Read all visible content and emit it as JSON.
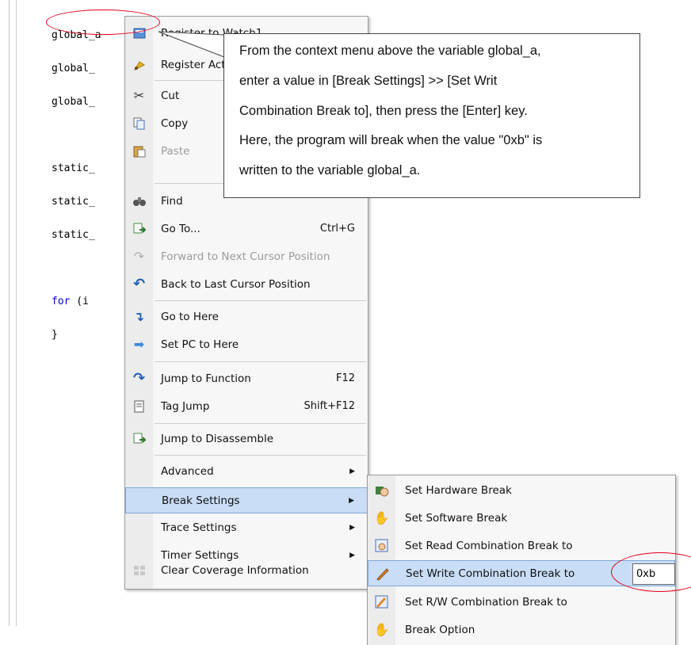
{
  "code_lines": [
    "global_a",
    "global_",
    "global_",
    "",
    "static_",
    "static_",
    "static_",
    "",
    "for (i",
    "}"
  ],
  "for_keyword": "for",
  "for_rest": " (i",
  "context_menu": {
    "items": [
      {
        "label": "Register to Watch1",
        "shortcut": "",
        "icon": "watch-icon"
      },
      {
        "label": "Register Action Event",
        "shortcut": "",
        "icon": "action-event-icon"
      },
      {
        "label": "Cut",
        "shortcut": "",
        "icon": "scissors-icon"
      },
      {
        "label": "Copy",
        "shortcut": "",
        "icon": "copy-icon"
      },
      {
        "label": "Paste",
        "shortcut": "",
        "icon": "paste-icon",
        "disabled": true
      },
      {
        "label": "Find",
        "shortcut": "",
        "icon": "binoculars-icon"
      },
      {
        "label": "Go To...",
        "shortcut": "Ctrl+G",
        "icon": "goto-icon"
      },
      {
        "label": "Forward to Next Cursor Position",
        "shortcut": "",
        "icon": "forward-icon",
        "disabled": true
      },
      {
        "label": "Back to Last Cursor Position",
        "shortcut": "",
        "icon": "back-icon"
      },
      {
        "label": "Go to Here",
        "shortcut": "",
        "icon": "go-here-icon"
      },
      {
        "label": "Set PC to Here",
        "shortcut": "",
        "icon": "set-pc-icon"
      },
      {
        "label": "Jump to Function",
        "shortcut": "F12",
        "icon": "jump-function-icon"
      },
      {
        "label": "Tag Jump",
        "shortcut": "Shift+F12",
        "icon": "tag-jump-icon"
      },
      {
        "label": "Jump to Disassemble",
        "shortcut": "",
        "icon": "disassemble-icon"
      },
      {
        "label": "Advanced",
        "shortcut": "",
        "submenu": true
      },
      {
        "label": "Break Settings",
        "shortcut": "",
        "submenu": true,
        "highlighted": true
      },
      {
        "label": "Trace Settings",
        "shortcut": "",
        "submenu": true
      },
      {
        "label": "Timer Settings",
        "shortcut": "",
        "submenu": true
      },
      {
        "label": "Clear Coverage Information",
        "shortcut": "",
        "icon": "coverage-icon"
      }
    ]
  },
  "break_submenu": {
    "items": [
      {
        "label": "Set Hardware Break",
        "icon": "hardware-break-icon"
      },
      {
        "label": "Set Software Break",
        "icon": "software-break-icon"
      },
      {
        "label": "Set Read Combination Break to",
        "icon": "read-break-icon"
      },
      {
        "label": "Set Write Combination Break to",
        "icon": "write-break-icon",
        "highlighted": true
      },
      {
        "label": "Set R/W Combination Break to",
        "icon": "rw-break-icon"
      },
      {
        "label": "Break Option",
        "icon": "break-option-icon"
      }
    ],
    "write_value": "0xb"
  },
  "callout": {
    "lines": [
      "From the context menu above the variable global_a,",
      "enter a value in [Break Settings] >> [Set Writ",
      "Combination Break to], then press the [Enter] key.",
      "Here, the program will break when the value \"0xb\" is",
      "written to the variable global_a."
    ]
  },
  "colors": {
    "highlight_oval": "#e0001a",
    "menu_highlight": "#c9ddf6",
    "keyword": "#0000c0"
  }
}
